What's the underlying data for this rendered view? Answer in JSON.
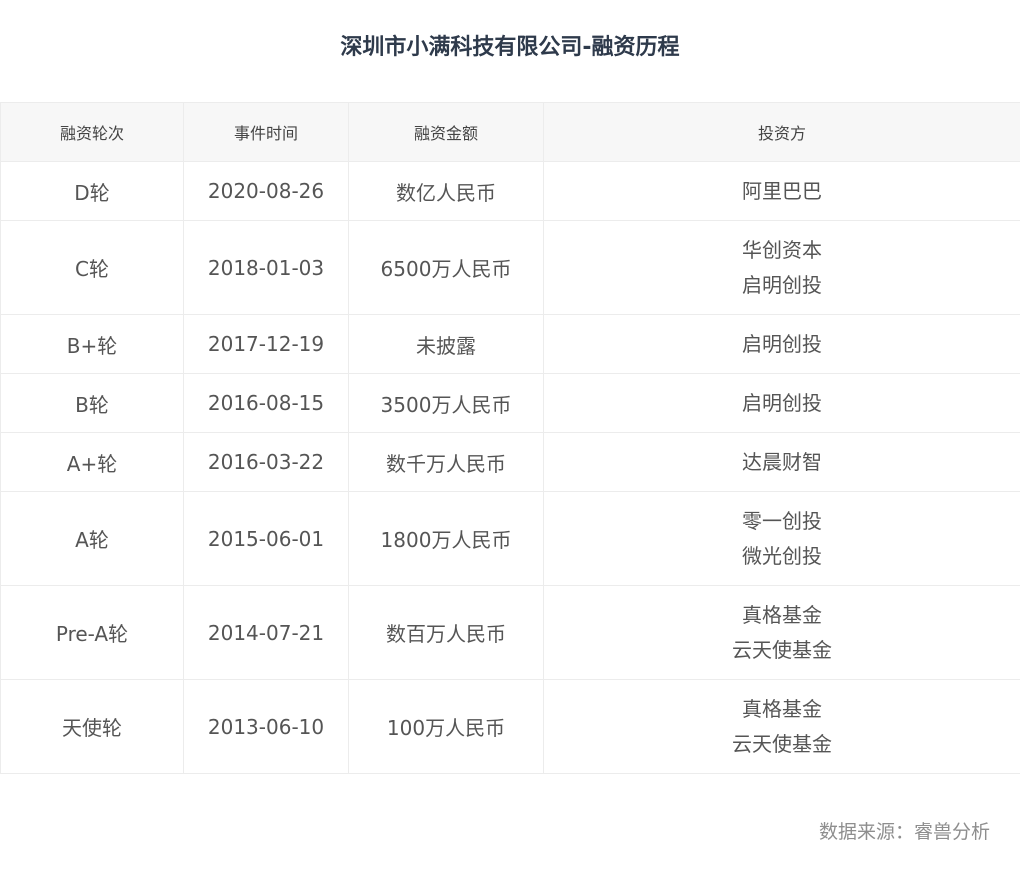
{
  "title": "深圳市小满科技有限公司-融资历程",
  "table": {
    "headers": [
      "融资轮次",
      "事件时间",
      "融资金额",
      "投资方"
    ],
    "rows": [
      {
        "round": "D轮",
        "date": "2020-08-26",
        "amount": "数亿人民币",
        "investors": [
          "阿里巴巴"
        ]
      },
      {
        "round": "C轮",
        "date": "2018-01-03",
        "amount": "6500万人民币",
        "investors": [
          "华创资本",
          "启明创投"
        ]
      },
      {
        "round": "B+轮",
        "date": "2017-12-19",
        "amount": "未披露",
        "investors": [
          "启明创投"
        ]
      },
      {
        "round": "B轮",
        "date": "2016-08-15",
        "amount": "3500万人民币",
        "investors": [
          "启明创投"
        ]
      },
      {
        "round": "A+轮",
        "date": "2016-03-22",
        "amount": "数千万人民币",
        "investors": [
          "达晨财智"
        ]
      },
      {
        "round": "A轮",
        "date": "2015-06-01",
        "amount": "1800万人民币",
        "investors": [
          "零一创投",
          "微光创投"
        ]
      },
      {
        "round": "Pre-A轮",
        "date": "2014-07-21",
        "amount": "数百万人民币",
        "investors": [
          "真格基金",
          "云天使基金"
        ]
      },
      {
        "round": "天使轮",
        "date": "2013-06-10",
        "amount": "100万人民币",
        "investors": [
          "真格基金",
          "云天使基金"
        ]
      }
    ]
  },
  "source": "数据来源：睿兽分析",
  "colors": {
    "title": "#2e3a4b",
    "investor_link": "#6b6bd6",
    "header_bg": "#f7f7f7",
    "border": "#ececec"
  }
}
